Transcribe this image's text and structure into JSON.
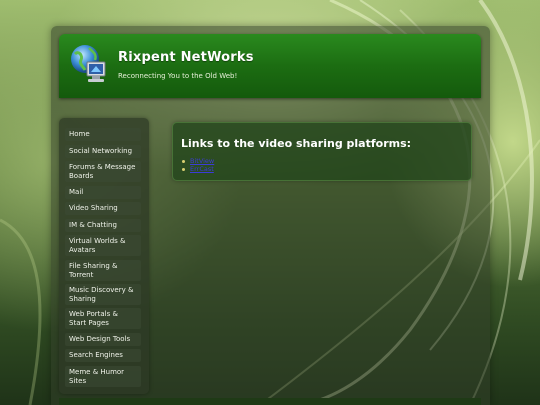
{
  "site": {
    "title": "Rixpent NetWorks",
    "tagline": "Reconnecting You to the Old Web!",
    "logo_icon": "globe-computer-icon"
  },
  "sidebar": {
    "items": [
      {
        "label": "Home"
      },
      {
        "label": "Social Networking"
      },
      {
        "label": "Forums & Message Boards"
      },
      {
        "label": "Mail"
      },
      {
        "label": "Video Sharing"
      },
      {
        "label": "IM & Chatting"
      },
      {
        "label": "Virtual Worlds & Avatars"
      },
      {
        "label": "File Sharing & Torrent"
      },
      {
        "label": "Music Discovery & Sharing"
      },
      {
        "label": "Web Portals & Start Pages"
      },
      {
        "label": "Web Design Tools"
      },
      {
        "label": "Search Engines"
      },
      {
        "label": "Meme & Humor Sites"
      }
    ]
  },
  "main": {
    "heading": "Links to the video sharing platforms:",
    "links": [
      {
        "label": "BitView"
      },
      {
        "label": "ErrCast"
      }
    ]
  },
  "colors": {
    "header_green": "#1c6d12",
    "link": "#3b3bd9",
    "bullet": "#d9d070"
  }
}
